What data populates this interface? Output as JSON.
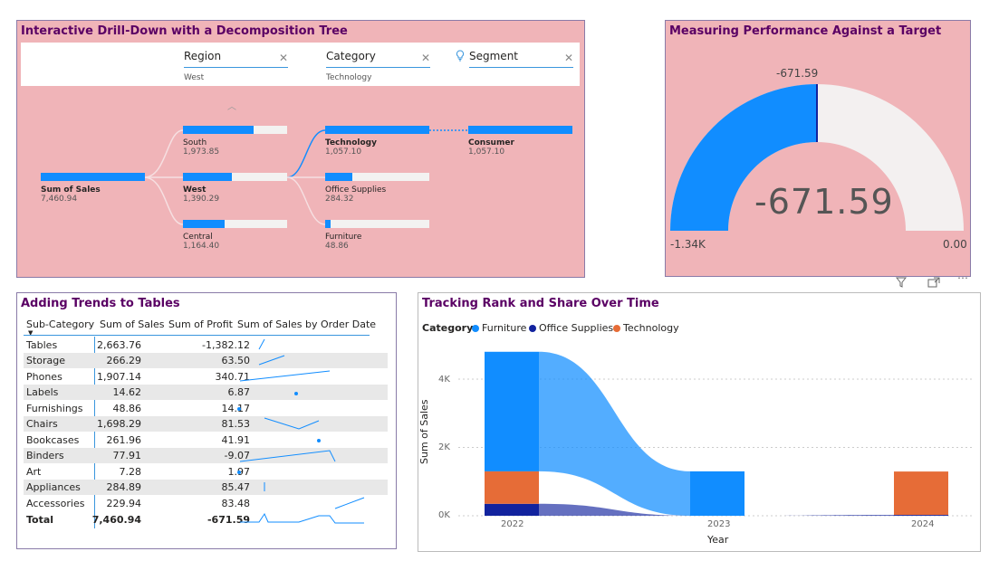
{
  "decomp": {
    "title": "Interactive Drill-Down with a Decomposition Tree",
    "levels": [
      {
        "name": "Region",
        "value": "West"
      },
      {
        "name": "Category",
        "value": "Technology"
      },
      {
        "name": "Segment"
      }
    ],
    "root": {
      "label": "Sum of Sales",
      "value": "7,460.94"
    },
    "regions": [
      {
        "label": "South",
        "value": "1,973.85",
        "fill": 0.68
      },
      {
        "label": "West",
        "value": "1,390.29",
        "fill": 0.47
      },
      {
        "label": "Central",
        "value": "1,164.40",
        "fill": 0.4
      }
    ],
    "categories": [
      {
        "label": "Technology",
        "value": "1,057.10",
        "fill": 1.0
      },
      {
        "label": "Office Supplies",
        "value": "284.32",
        "fill": 0.26
      },
      {
        "label": "Furniture",
        "value": "48.86",
        "fill": 0.05
      }
    ],
    "segment": {
      "label": "Consumer",
      "value": "1,057.10",
      "fill": 1.0
    }
  },
  "gauge": {
    "title": "Measuring Performance Against a Target",
    "value_label": "-671.59",
    "big_value": "-671.59",
    "min_label": "-1.34K",
    "max_label": "0.00",
    "fill_fraction": 0.5,
    "color_fill": "#118dff",
    "color_track": "#f3f0f0"
  },
  "table": {
    "title": "Adding Trends to Tables",
    "headers": [
      "Sub-Category",
      "Sum of Sales",
      "Sum of Profit",
      "Sum of Sales by Order Date"
    ],
    "rows": [
      {
        "sub": "Tables",
        "sales": "2,663.76",
        "profit": "-1,382.12"
      },
      {
        "sub": "Storage",
        "sales": "266.29",
        "profit": "63.50"
      },
      {
        "sub": "Phones",
        "sales": "1,907.14",
        "profit": "340.71"
      },
      {
        "sub": "Labels",
        "sales": "14.62",
        "profit": "6.87"
      },
      {
        "sub": "Furnishings",
        "sales": "48.86",
        "profit": "14.17"
      },
      {
        "sub": "Chairs",
        "sales": "1,698.29",
        "profit": "81.53"
      },
      {
        "sub": "Bookcases",
        "sales": "261.96",
        "profit": "41.91"
      },
      {
        "sub": "Binders",
        "sales": "77.91",
        "profit": "-9.07"
      },
      {
        "sub": "Art",
        "sales": "7.28",
        "profit": "1.97"
      },
      {
        "sub": "Appliances",
        "sales": "284.89",
        "profit": "85.47"
      },
      {
        "sub": "Accessories",
        "sales": "229.94",
        "profit": "83.48"
      }
    ],
    "total": {
      "sub": "Total",
      "sales": "7,460.94",
      "profit": "-671.59"
    }
  },
  "ribbon": {
    "title": "Tracking Rank and Share Over Time",
    "legend_title": "Category",
    "legend": [
      {
        "name": "Furniture",
        "color": "#118dff"
      },
      {
        "name": "Office Supplies",
        "color": "#12239e"
      },
      {
        "name": "Technology",
        "color": "#e66c37"
      }
    ],
    "ylabel": "Sum of Sales",
    "xlabel": "Year",
    "yticks": [
      "4K",
      "2K",
      "0K"
    ]
  },
  "chart_data": {
    "type": "bar",
    "title": "Tracking Rank and Share Over Time",
    "xlabel": "Year",
    "ylabel": "Sum of Sales",
    "categories": [
      "2022",
      "2023",
      "2024"
    ],
    "series": [
      {
        "name": "Office Supplies",
        "values": [
          350,
          0,
          25
        ]
      },
      {
        "name": "Technology",
        "values": [
          950,
          0,
          1270
        ]
      },
      {
        "name": "Furniture",
        "values": [
          3500,
          1300,
          0
        ]
      }
    ],
    "ylim": [
      0,
      4900
    ],
    "grid": true,
    "legend_position": "top-left"
  }
}
